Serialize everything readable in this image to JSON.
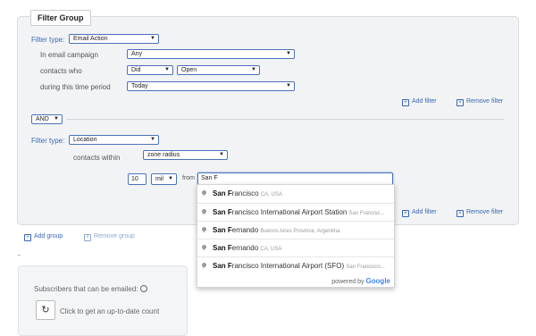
{
  "filter_group": {
    "title": "Filter Group",
    "filter1": {
      "type_label": "Filter type:",
      "type_value": "Email Action",
      "rows": [
        {
          "label": "In email campaign",
          "value": "Any"
        },
        {
          "label": "contacts who",
          "value": "Did",
          "value2": "Open"
        },
        {
          "label": "during this time period",
          "value": "Today"
        }
      ],
      "add_filter": "Add filter",
      "remove_filter": "Remove filter"
    },
    "connector": "AND",
    "filter2": {
      "type_label": "Filter type:",
      "type_value": "Location",
      "within_label": "contacts within",
      "within_value": "zone radius",
      "radius_value": "10",
      "unit_value": "mil",
      "from_label": "from",
      "from_value": "San F",
      "add_filter": "Add filter",
      "remove_filter": "Remove filter"
    }
  },
  "autocomplete": {
    "items": [
      {
        "match": "San F",
        "rest": "rancisco",
        "secondary": "CA, USA"
      },
      {
        "match": "San F",
        "rest": "rancisco International Airport Station",
        "secondary": "San Francisc..."
      },
      {
        "match": "San F",
        "rest": "ernando",
        "secondary": "Buenos Aires Province, Argentina"
      },
      {
        "match": "San F",
        "rest": "ernando",
        "secondary": "CA, USA"
      },
      {
        "match": "San F",
        "rest": "rancisco International Airport (SFO)",
        "secondary": "San Francisco..."
      }
    ],
    "powered_by": "powered by",
    "brand": "Google"
  },
  "actions": {
    "add_group": "Add group",
    "remove_group": "Remove group"
  },
  "subscribers": {
    "label": "Subscribers that can be emailed:",
    "refresh_text": "Click to get an up-to-date count"
  },
  "colors": {
    "accent": "#3a68b2",
    "panel": "#f2f3f5"
  }
}
